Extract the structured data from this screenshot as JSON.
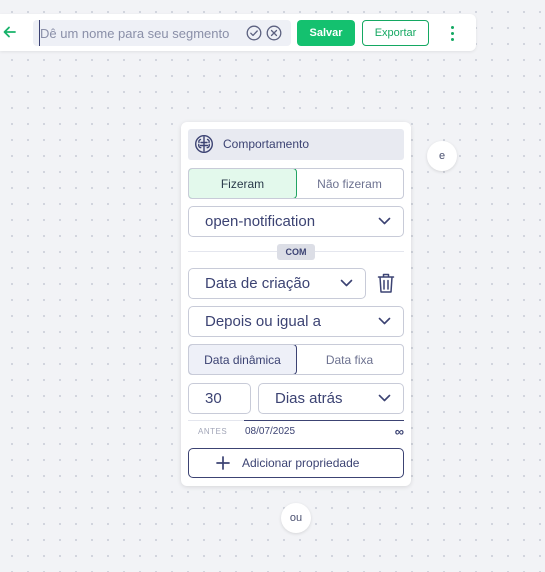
{
  "toolbar": {
    "name_placeholder": "Dê um nome para seu segmento",
    "name_value": "",
    "save_label": "Salvar",
    "export_label": "Exportar"
  },
  "colors": {
    "accent_green": "#14c16f",
    "navy": "#3c4373",
    "canvas_bg": "#f2f3f6"
  },
  "card": {
    "title": "Comportamento",
    "action_toggle": {
      "options": [
        "Fizeram",
        "Não fizeram"
      ],
      "selected": "Fizeram"
    },
    "event_select": "open-notification",
    "connector_badge": "COM",
    "property_select": "Data de criação",
    "operator_select": "Depois ou igual a",
    "date_mode_toggle": {
      "options": [
        "Data dinâmica",
        "Data fixa"
      ],
      "selected": "Data dinâmica"
    },
    "amount_value": "30",
    "unit_select": "Dias atrás",
    "range": {
      "label": "ANTES",
      "date": "08/07/2025",
      "end": "∞"
    },
    "add_property_label": "Adicionar propriedade"
  },
  "side_and_bubble": "e",
  "bottom_or_bubble": "ou",
  "icons": [
    "back-arrow-icon",
    "check-circle-icon",
    "clear-circle-icon",
    "kebab-menu-icon",
    "brain-icon",
    "chevron-down-icon",
    "trash-icon",
    "plus-icon"
  ]
}
